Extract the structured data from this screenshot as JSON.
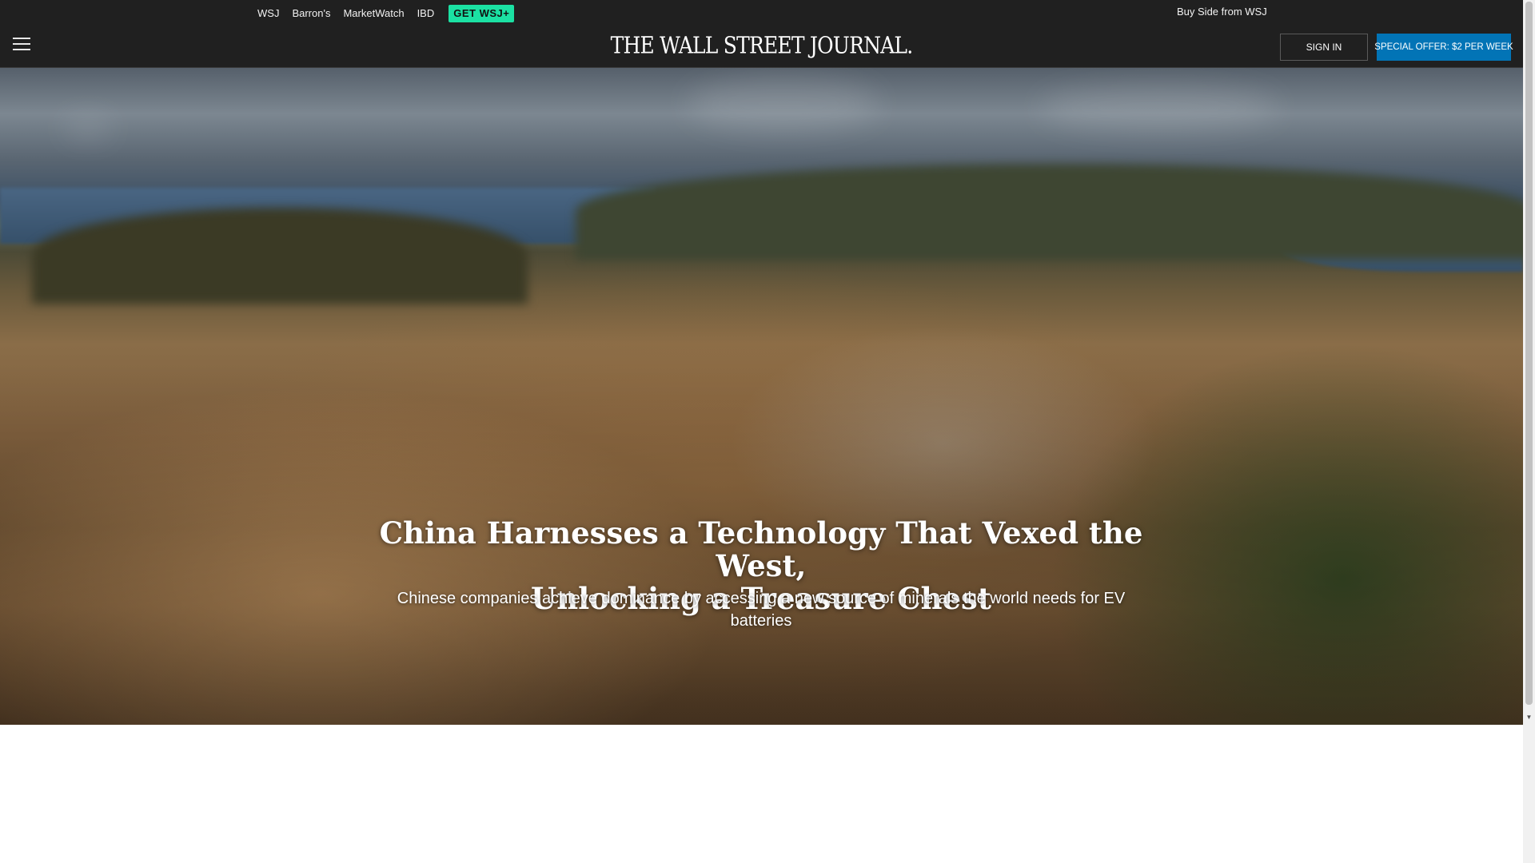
{
  "topbar": {
    "brand_links": [
      "WSJ",
      "Barron's",
      "MarketWatch",
      "IBD"
    ],
    "get_wsj_label": "GET WSJ+",
    "buy_side_link": "Buy Side from WSJ",
    "menu_icon": "hamburger-menu-icon",
    "logo_text": "THE WALL STREET JOURNAL.",
    "sign_in_label": "SIGN IN",
    "special_offer_label": "SPECIAL OFFER: $2 PER WEEK"
  },
  "hero": {
    "headline_line1": "China Harnesses a Technology That Vexed the West,",
    "headline_line2": "Unlocking a Treasure Chest",
    "dek": "Chinese companies achieve dominance by accessing a new source of minerals the world needs for EV batteries"
  },
  "colors": {
    "topbar_bg": "#202020",
    "get_wsj_bg": "#1be1a3",
    "offer_bg": "#0274b6",
    "page_bg": "#ffffff"
  }
}
